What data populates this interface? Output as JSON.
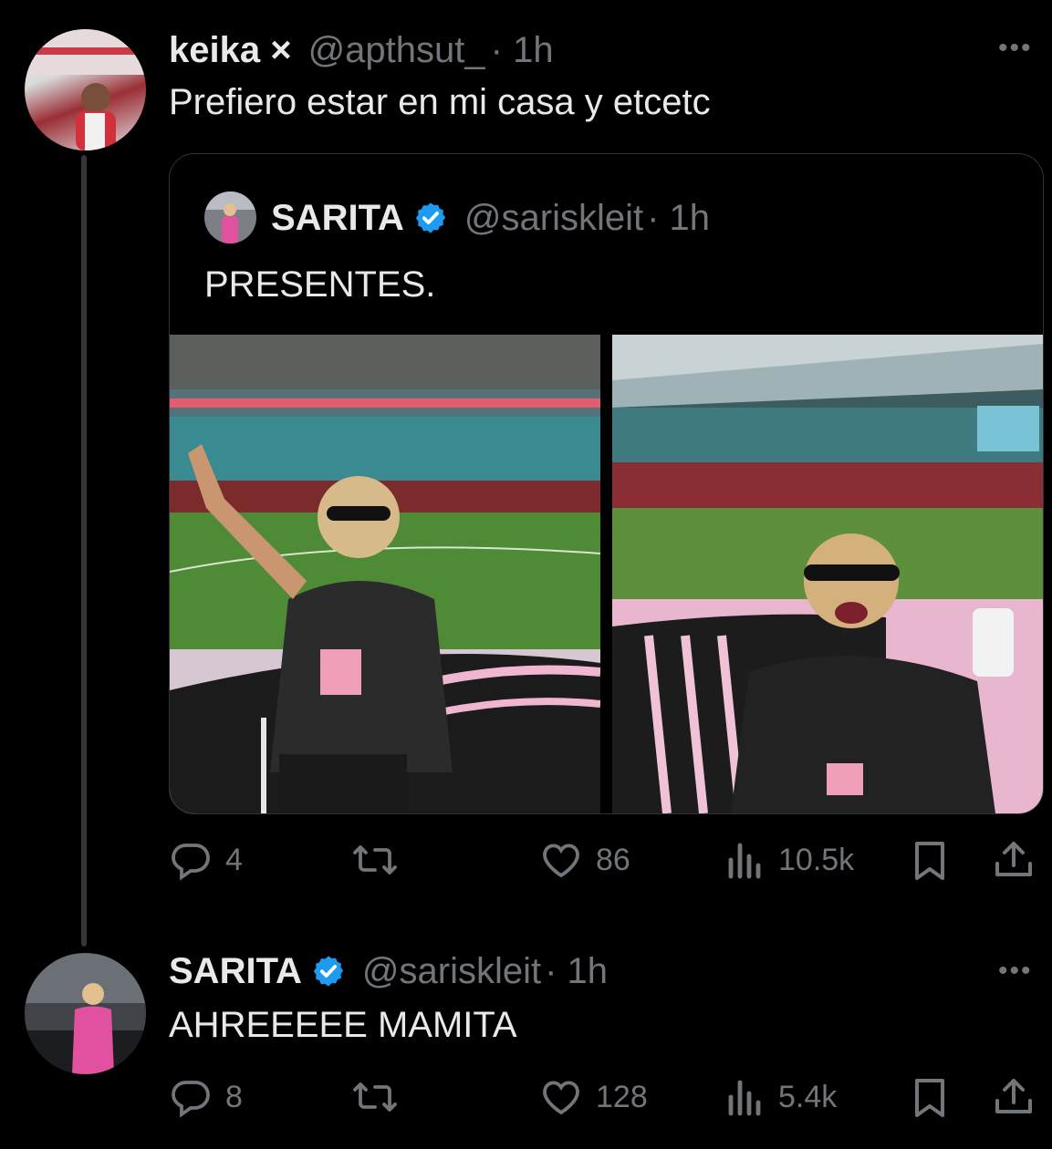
{
  "thread": {
    "tweet1": {
      "display_name": "keika ×",
      "handle": "@apthsut_",
      "time": "· 1h",
      "text": "Prefiero estar en mi casa y etcetc",
      "more": "•••",
      "quote": {
        "display_name": "SARITA",
        "handle": "@sariskleit",
        "time": "· 1h",
        "text": "PRESENTES.",
        "verified": true
      },
      "actions": {
        "replies": "4",
        "reposts": "",
        "likes": "86",
        "views": "10.5k"
      }
    },
    "tweet2": {
      "display_name": "SARITA",
      "handle": "@sariskleit",
      "time": "· 1h",
      "text": "AHREEEEE MAMITA",
      "more": "•••",
      "verified": true,
      "actions": {
        "replies": "8",
        "reposts": "",
        "likes": "128",
        "views": "5.4k"
      }
    }
  },
  "colors": {
    "background": "#000000",
    "text": "#e7e9ea",
    "muted": "#71767b",
    "verified_blue": "#1d9bf0",
    "border": "#2f3336"
  },
  "icons": [
    "reply-icon",
    "repost-icon",
    "like-icon",
    "views-icon",
    "bookmark-icon",
    "share-icon",
    "verified-badge-icon",
    "more-icon"
  ]
}
